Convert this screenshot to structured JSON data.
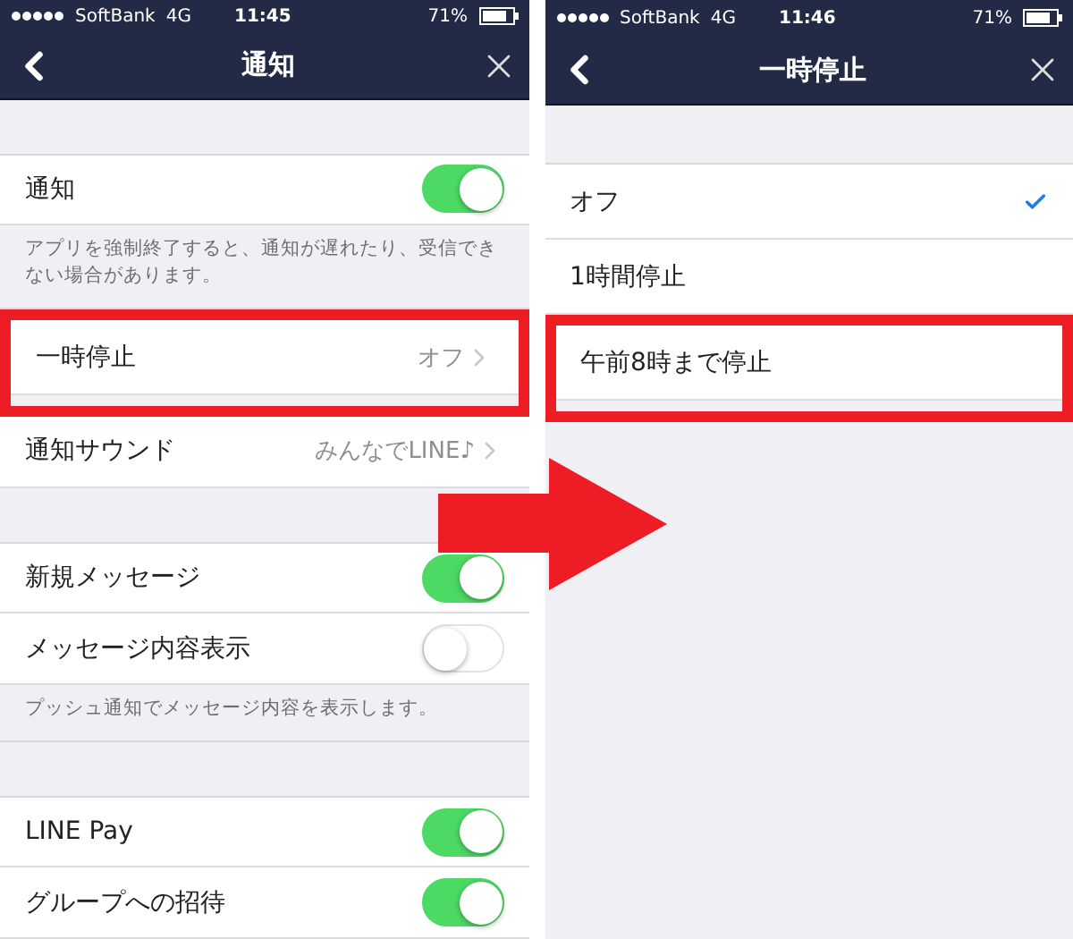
{
  "screens": [
    {
      "status": {
        "carrier": "SoftBank",
        "network": "4G",
        "time": "11:45",
        "battery": "71%"
      },
      "title": "通知",
      "rows": [
        {
          "kind": "spacer"
        },
        {
          "kind": "toggle",
          "label": "通知",
          "on": true
        },
        {
          "kind": "note",
          "text": "アプリを強制終了すると、通知が遅れたり、受信できない場合があります。"
        },
        {
          "kind": "link",
          "label": "一時停止",
          "value": "オフ",
          "highlighted": true
        },
        {
          "kind": "link",
          "label": "通知サウンド",
          "value": "みんなでLINE♪",
          "highlighted": false
        },
        {
          "kind": "spacer"
        },
        {
          "kind": "toggle",
          "label": "新規メッセージ",
          "on": true
        },
        {
          "kind": "toggle",
          "label": "メッセージ内容表示",
          "on": false
        },
        {
          "kind": "note",
          "text": "プッシュ通知でメッセージ内容を表示します。"
        },
        {
          "kind": "spacer"
        },
        {
          "kind": "toggle",
          "label": "LINE Pay",
          "on": true
        },
        {
          "kind": "toggle",
          "label": "グループへの招待",
          "on": true
        }
      ]
    },
    {
      "status": {
        "carrier": "SoftBank",
        "network": "4G",
        "time": "11:46",
        "battery": "71%"
      },
      "title": "一時停止",
      "rows": [
        {
          "kind": "spacer"
        },
        {
          "kind": "option",
          "label": "オフ",
          "selected": true,
          "highlighted": false
        },
        {
          "kind": "option",
          "label": "1時間停止",
          "selected": false,
          "highlighted": false
        },
        {
          "kind": "option",
          "label": "午前8時まで停止",
          "selected": false,
          "highlighted": true
        }
      ]
    }
  ]
}
